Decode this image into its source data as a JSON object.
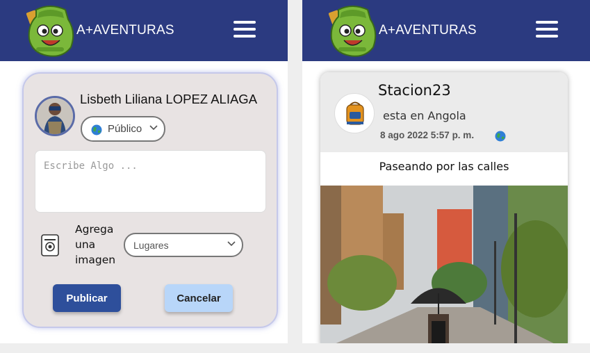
{
  "app": {
    "brand_name": "A+AVENTURAS",
    "header_color": "#2b3a80"
  },
  "create_post": {
    "user_name": "Lisbeth Liliana LOPEZ ALIAGA",
    "privacy": {
      "selected": "Público",
      "icon": "globe-icon"
    },
    "textarea_placeholder": "Escribe Algo ...",
    "add_image_label": "Agrega una imagen",
    "places_select": {
      "selected": "Lugares"
    },
    "publish_label": "Publicar",
    "cancel_label": "Cancelar"
  },
  "feed_post": {
    "user_name": "Stacion23",
    "location_text": "esta en Angola",
    "timestamp": "8 ago 2022 5:57 p. m.",
    "caption": "Paseando por las calles",
    "icons": {
      "avatar": "backpack-icon",
      "visibility": "globe-icon"
    }
  }
}
